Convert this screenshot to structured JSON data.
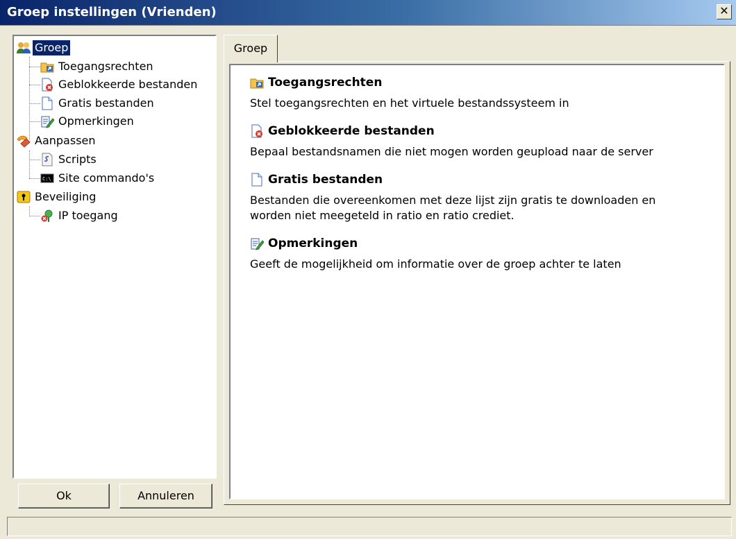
{
  "window": {
    "title": "Groep instellingen (Vrienden)",
    "close_glyph": "✕"
  },
  "tree": {
    "items": [
      {
        "label": "Groep",
        "icon": "users-icon"
      },
      {
        "label": "Toegangsrechten",
        "icon": "folder-shortcut-icon"
      },
      {
        "label": "Geblokkeerde bestanden",
        "icon": "blocked-file-icon"
      },
      {
        "label": "Gratis bestanden",
        "icon": "file-icon"
      },
      {
        "label": "Opmerkingen",
        "icon": "note-edit-icon"
      },
      {
        "label": "Aanpassen",
        "icon": "customize-icon"
      },
      {
        "label": "Scripts",
        "icon": "script-icon"
      },
      {
        "label": "Site commando's",
        "icon": "console-icon"
      },
      {
        "label": "Beveiliging",
        "icon": "security-lock-icon"
      },
      {
        "label": "IP toegang",
        "icon": "ip-access-icon"
      }
    ]
  },
  "buttons": {
    "ok": "Ok",
    "cancel": "Annuleren"
  },
  "tab": {
    "label": "Groep"
  },
  "sections": [
    {
      "title": "Toegangsrechten",
      "desc": "Stel toegangsrechten en het virtuele bestandssysteem in"
    },
    {
      "title": "Geblokkeerde bestanden",
      "desc": "Bepaal bestandsnamen die niet mogen worden geupload naar de server"
    },
    {
      "title": "Gratis bestanden",
      "desc": "Bestanden die overeenkomen met deze lijst zijn gratis te downloaden en worden niet meegeteld in ratio en ratio crediet."
    },
    {
      "title": "Opmerkingen",
      "desc": "Geeft de mogelijkheid om informatie over de groep achter te laten"
    }
  ],
  "console_glyph": "C:\\"
}
